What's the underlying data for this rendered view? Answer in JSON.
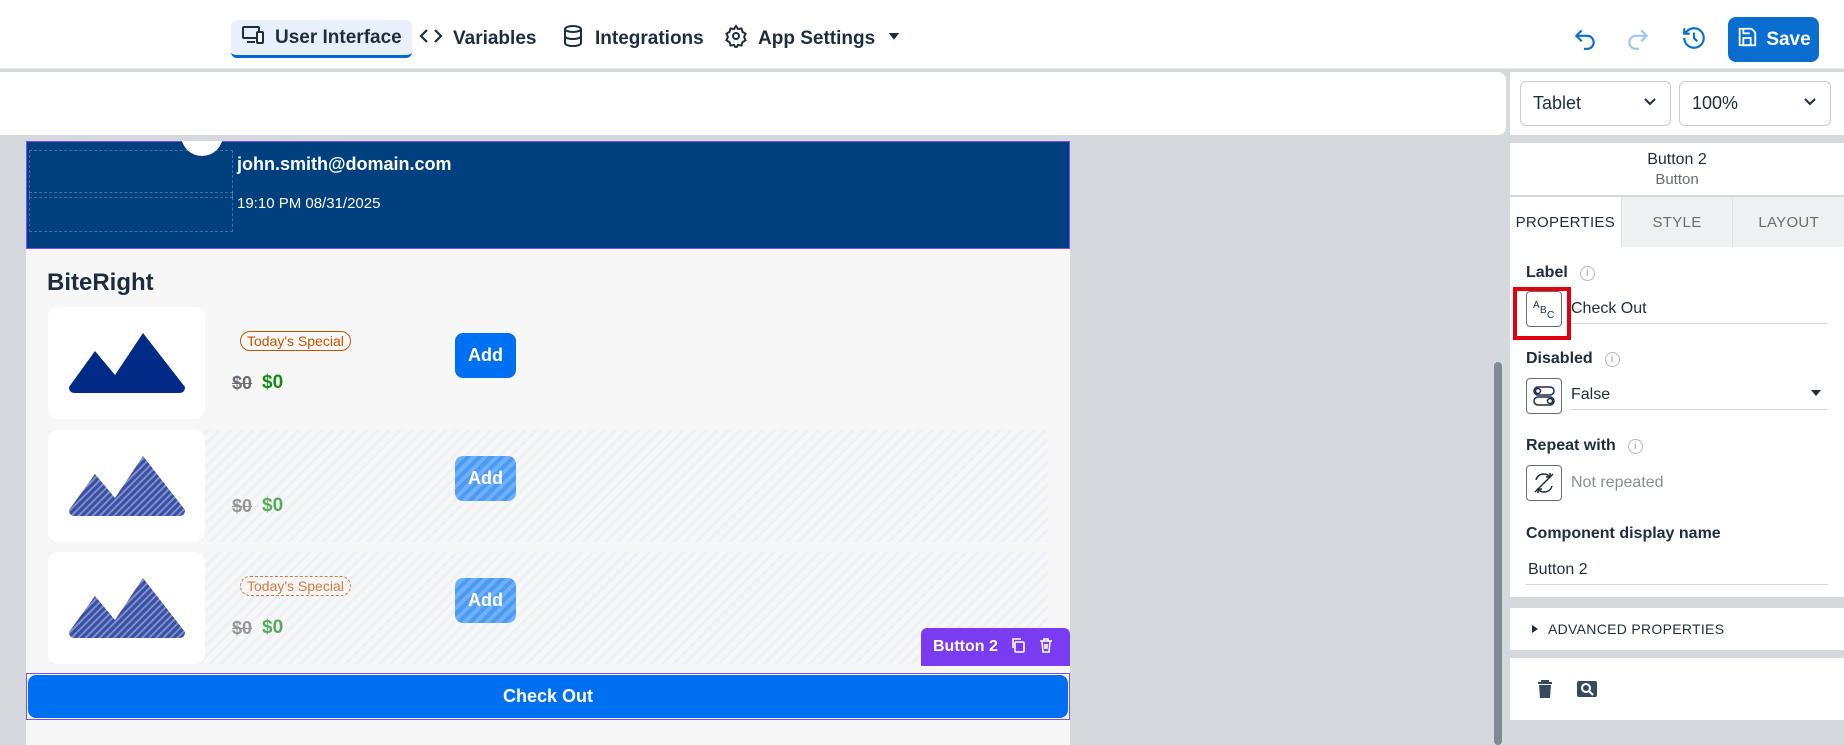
{
  "topbar": {
    "tabs": [
      {
        "label": "User Interface",
        "icon": "devices-icon",
        "active": true
      },
      {
        "label": "Variables",
        "icon": "code-icon"
      },
      {
        "label": "Integrations",
        "icon": "database-icon"
      },
      {
        "label": "App Settings",
        "icon": "gear-icon"
      }
    ],
    "save_label": "Save",
    "accent": "#0a6ed1"
  },
  "canvas_toolbar": {
    "device": "Tablet",
    "zoom": "100%"
  },
  "app_preview": {
    "email": "john.smith@domain.com",
    "datetime": "19:10 PM 08/31/2025",
    "store_name": "BiteRight",
    "items": [
      {
        "badge": "Today's Special",
        "old_price": "$0",
        "new_price": "$0",
        "button": "Add"
      },
      {
        "badge": "",
        "old_price": "$0",
        "new_price": "$0",
        "button": "Add"
      },
      {
        "badge": "Today's Special",
        "old_price": "$0",
        "new_price": "$0",
        "button": "Add"
      }
    ],
    "selected_tag": "Button 2",
    "checkout_label": "Check Out"
  },
  "properties_panel": {
    "component_name": "Button 2",
    "component_type": "Button",
    "tabs": [
      "PROPERTIES",
      "STYLE",
      "LAYOUT"
    ],
    "active_tab": "PROPERTIES",
    "label_title": "Label",
    "label_value": "Check Out",
    "disabled_title": "Disabled",
    "disabled_value": "False",
    "repeat_title": "Repeat with",
    "repeat_value": "Not repeated",
    "display_name_title": "Component display name",
    "display_name_value": "Button 2",
    "advanced_label": "ADVANCED PROPERTIES"
  }
}
